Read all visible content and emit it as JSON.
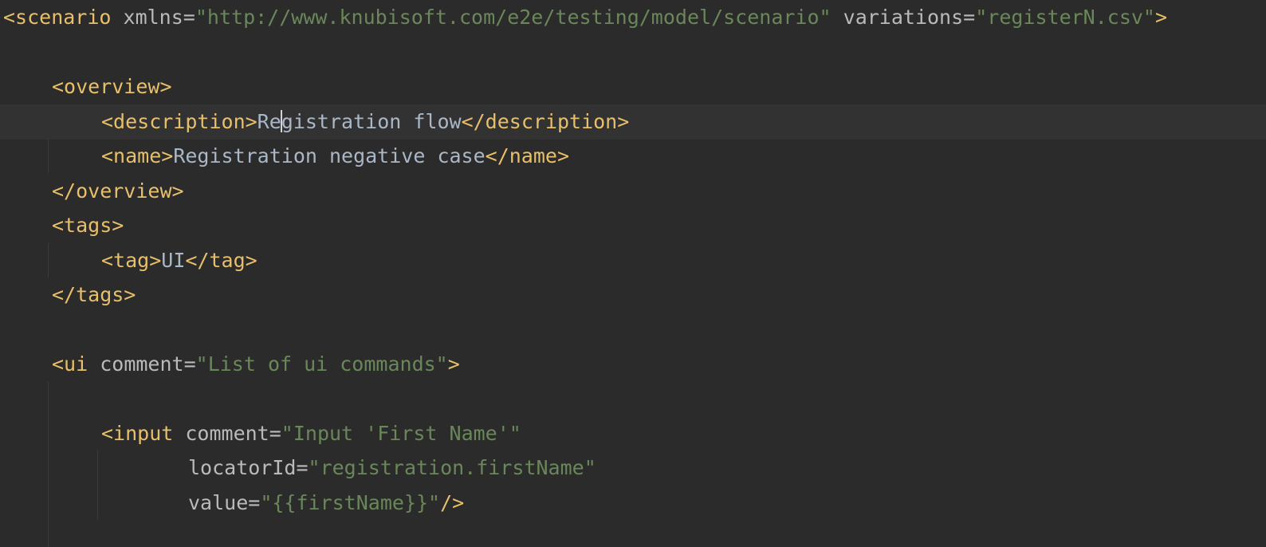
{
  "editor": {
    "lines": {
      "l1": {
        "open": "<scenario",
        "attr1": "xmlns",
        "eq1": "=",
        "val1": "\"http://www.knubisoft.com/e2e/testing/model/scenario\"",
        "attr2": "variations",
        "eq2": "=",
        "val2": "\"registerN.csv\"",
        "close": ">"
      },
      "l3": {
        "tag": "<overview>"
      },
      "l4": {
        "open": "<description>",
        "text_before_caret": "Re",
        "text_after_caret": "gistration flow",
        "close": "</description>"
      },
      "l5": {
        "open": "<name>",
        "text": "Registration negative case",
        "close": "</name>"
      },
      "l6": {
        "tag": "</overview>"
      },
      "l7": {
        "tag": "<tags>"
      },
      "l8": {
        "open": "<tag>",
        "text": "UI",
        "close": "</tag>"
      },
      "l9": {
        "tag": "</tags>"
      },
      "l11": {
        "open": "<ui",
        "attr": "comment",
        "eq": "=",
        "val": "\"List of ui commands\"",
        "close": ">"
      },
      "l13": {
        "open": "<input",
        "attr": "comment",
        "eq": "=",
        "val": "\"Input 'First Name'\""
      },
      "l14": {
        "attr": "locatorId",
        "eq": "=",
        "val": "\"registration.firstName\""
      },
      "l15": {
        "attr": "value",
        "eq": "=",
        "val": "\"{{firstName}}\"",
        "close": "/>"
      }
    },
    "colors": {
      "background": "#2b2b2b",
      "current_line": "#323232",
      "tag": "#e8bf6a",
      "attribute": "#bababa",
      "string": "#6a8759",
      "text": "#a9b7c6",
      "bulb": "#f0b429"
    },
    "gutter_icon": "lightbulb-icon"
  }
}
